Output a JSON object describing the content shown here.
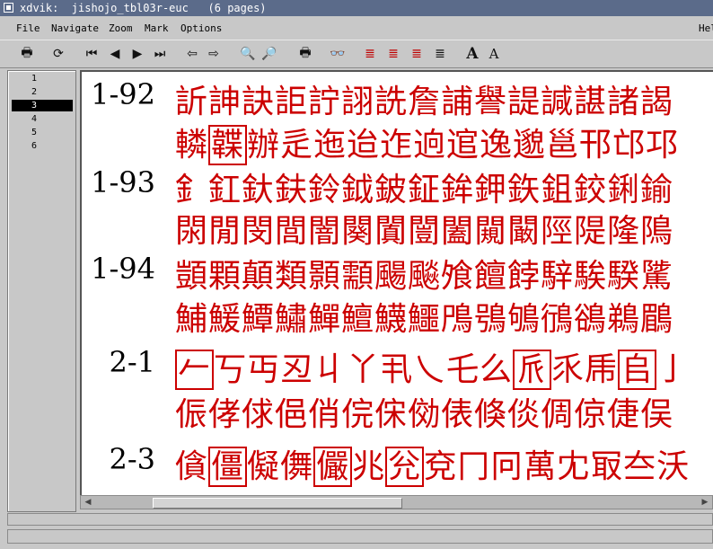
{
  "window": {
    "title": "xdvik:  jishojo_tbl03r-euc   (6 pages)",
    "buttons": [
      "_",
      "□",
      "×"
    ]
  },
  "menubar": {
    "items": [
      "File",
      "Navigate",
      "Zoom",
      "Mark",
      "Options",
      "Help"
    ]
  },
  "toolbar": {
    "icons": {
      "print": "🖶",
      "reload": "⟳",
      "first": "⏮",
      "prev": "◀",
      "next": "▶",
      "last": "⏭",
      "back": "⇦",
      "forward": "⇨",
      "zoom_in": "🔍",
      "zoom_out": "🔎",
      "printer": "🖶",
      "binoculars": "👓",
      "mark1": "≣",
      "mark2": "≣",
      "mark3": "≣",
      "mark4": "≣",
      "font_large": "A",
      "font_small": "A"
    }
  },
  "pagelist": {
    "pages": [
      "1",
      "2",
      "3",
      "4",
      "5",
      "6"
    ],
    "selected": "3"
  },
  "document": {
    "rows": [
      {
        "label": "1-92",
        "chars": "訢訷訣詎詝詡詵詹誧譽諟諴諶諸謁"
      },
      {
        "label": "",
        "chars_a": "轔",
        "boxed": "韘",
        "chars_b": "辦辵迤迨迮逈逭逸邈邕邗邙邛"
      },
      {
        "label": "1-93",
        "chars": "釒釭釱鈇鈴鉞鈹鉦鉾鉀鉃鉏鉸鋓鍮"
      },
      {
        "label": "",
        "chars": "閖閒閔閭闇闋闐闓闔闚闞陘隄隆隝"
      },
      {
        "label": "1-94",
        "chars": "顗顆顛類顥顬颺飈飧饘餑騂騃騤騭"
      },
      {
        "label": "",
        "chars": "鯆鰀鱏鱐鱓鱣鱴鱷鳲鴞鴝鴴鵒鵜鶥"
      },
      {
        "label": "2-1",
        "b1": "𠂉",
        "mid1": "丂丏丒丩丫丮乀乇么",
        "b2": "𠂢",
        "mid2": "乑乕",
        "b3": "𠂤",
        "tail": "亅"
      },
      {
        "label": "",
        "chars": "侲侾俅俋俏俒俕俲俵倏倓倜倞倢俣"
      },
      {
        "label": "2-3",
        "a": "僋",
        "b1": "僵",
        "m1": "儗儛",
        "b2": "儼",
        "m2": "兆",
        "b3": "兊",
        "tail": "兗冂冋萬冘冣夳沃"
      }
    ]
  }
}
